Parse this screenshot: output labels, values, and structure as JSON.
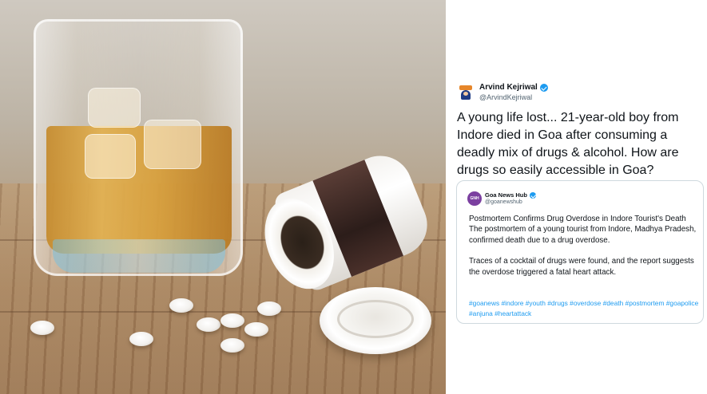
{
  "photo": {
    "description_icon": "whisky-and-pills-photo"
  },
  "tweet": {
    "author_name": "Arvind Kejriwal",
    "author_handle": "@ArvindKejriwal",
    "text": "A young life lost... 21-year-old boy from Indore died in Goa after consuming a deadly mix of drugs & alcohol. How are drugs so easily accessible in Goa?",
    "verified_color": "#1d9bf0"
  },
  "quote": {
    "author_name": "Goa News Hub",
    "author_handle": "@goanewshub",
    "avatar_color": "#7b3fa0",
    "paragraph_1": "Postmortem Confirms Drug Overdose in Indore Tourist's Death The postmortem of a young tourist from Indore, Madhya Pradesh, confirmed death due to a drug overdose.",
    "paragraph_2": "Traces of a cocktail of drugs were found, and the report suggests the overdose triggered a fatal heart attack.",
    "hashtags": "#goanews #indore #youth #drugs #overdose #death #postmortem #goapolice #anjuna #heartattack",
    "hashtag_color": "#1d9bf0"
  }
}
